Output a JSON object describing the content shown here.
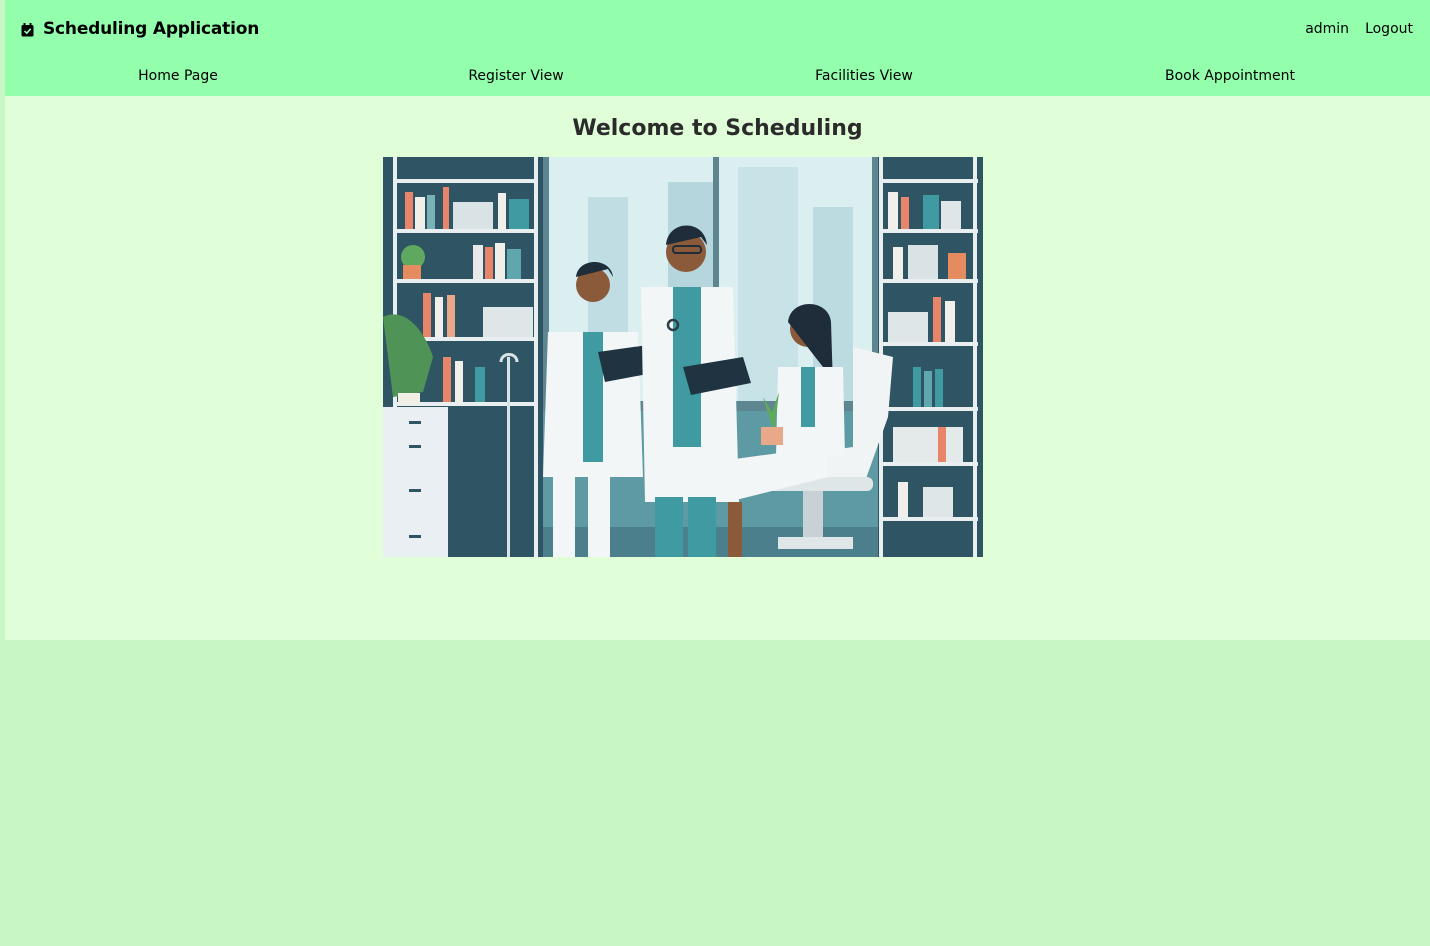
{
  "header": {
    "app_title": "Scheduling Application",
    "brand_icon": "calendar-check-icon",
    "user_name": "admin",
    "logout_label": "Logout"
  },
  "nav": {
    "items": [
      {
        "label": "Home Page"
      },
      {
        "label": "Register View"
      },
      {
        "label": "Facilities View"
      },
      {
        "label": "Book Appointment"
      }
    ]
  },
  "main": {
    "heading": "Welcome to Scheduling",
    "hero_image": "illustration of doctors with patient in clinic office"
  },
  "colors": {
    "header_bg": "#93ffad",
    "content_bg": "#e0ffd9",
    "page_bg": "#c8f7c5"
  }
}
